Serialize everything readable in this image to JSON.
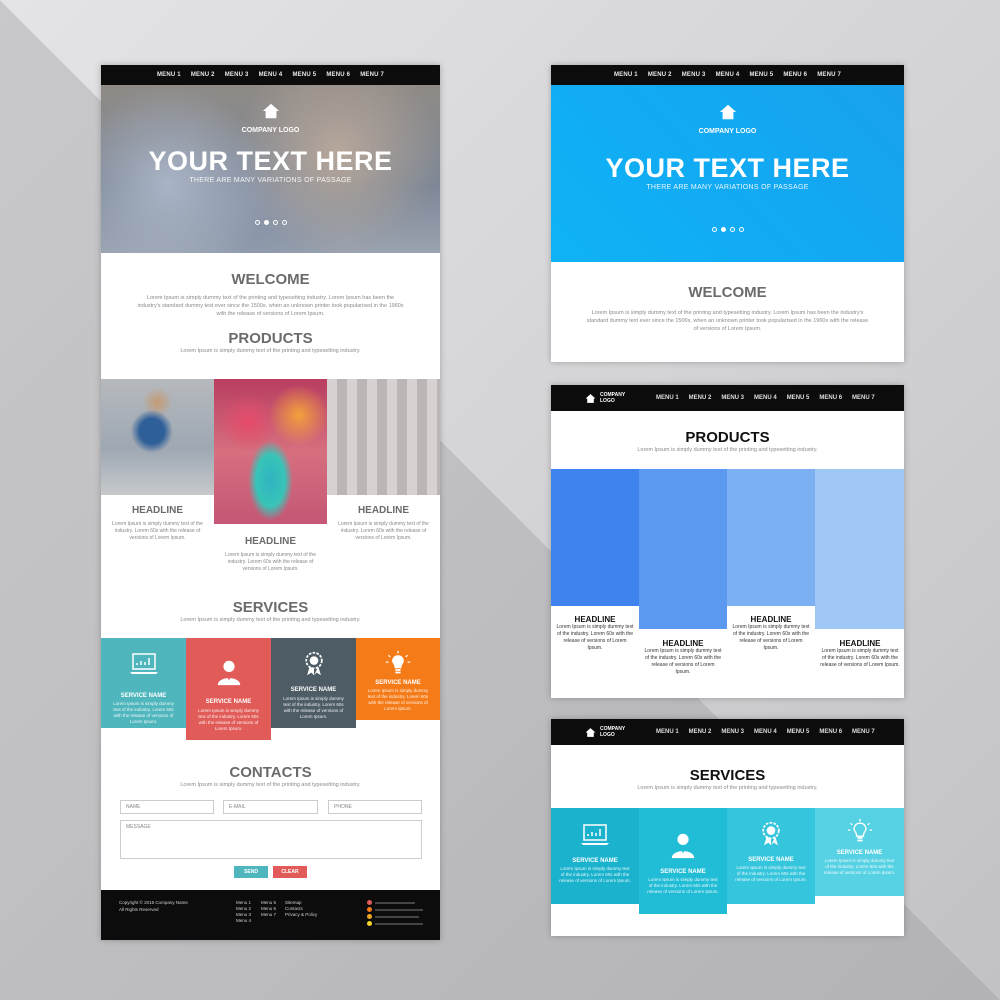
{
  "menu": [
    "MENU 1",
    "MENU 2",
    "MENU 3",
    "MENU 4",
    "MENU 5",
    "MENU 6",
    "MENU 7"
  ],
  "logo": "COMPANY LOGO",
  "hero": {
    "title": "YOUR TEXT HERE",
    "subtitle": "THERE ARE MANY VARIATIONS OF PASSAGE"
  },
  "welcome": {
    "title": "WELCOME",
    "text": "Lorem Ipsum is simply dummy text of the printing and typesetting industry. Lorem Ipsum has been the industry's standard dummy text ever since the 1500s, when an unknown printer took popularised in the 1960s with the release of versions of Lorem Ipsum."
  },
  "products": {
    "title": "PRODUCTS",
    "text": "Lorem Ipsum is simply dummy text of the printing and typesetting industry.",
    "headline": "HEADLINE",
    "item_text": "Lorem Ipsum is simply dummy text of the industry. Lorem 60s with the release of versions of Lorem Ipsum."
  },
  "services": {
    "title": "SERVICES",
    "text": "Lorem Ipsum is simply dummy text of the printing and typesetting industry.",
    "name": "SERVICE NAME",
    "item_text": "Lorem Ipsum is simply dummy text of the industry. Lorem 60s with the release of versions of Lorem Ipsum."
  },
  "contacts": {
    "title": "CONTACTS",
    "text": "Lorem Ipsum is simply dummy text of the printing and typesetting industry.",
    "name_ph": "NAME",
    "email_ph": "E-MAIL",
    "phone_ph": "PHONE",
    "message_ph": "MESSAGE",
    "send": "SEND",
    "clear": "CLEAR"
  },
  "footer": {
    "copyright": "Copyright © 2016 Company Name",
    "rights": "All Rights Reserved",
    "col1": [
      "Menu 1",
      "Menu 2",
      "Menu 3",
      "Menu 4"
    ],
    "col2": [
      "Menu 5",
      "Menu 6",
      "Menu 7"
    ],
    "col3": [
      "Sitemap",
      "Contacts",
      "Privacy & Policy"
    ]
  },
  "colors": {
    "teal": "#4fb6bd",
    "red": "#e15c58",
    "slate": "#4e5c66",
    "orange": "#f57b18",
    "sky": "#12a8f2",
    "blue1": "#3f84ee",
    "blue2": "#5b99f0",
    "blue3": "#7db0f3",
    "blue4": "#9fc7f6",
    "cyan1": "#1ab2cd",
    "cyan2": "#21bcd6",
    "cyan3": "#35c5dc",
    "cyan4": "#57d2e4"
  }
}
